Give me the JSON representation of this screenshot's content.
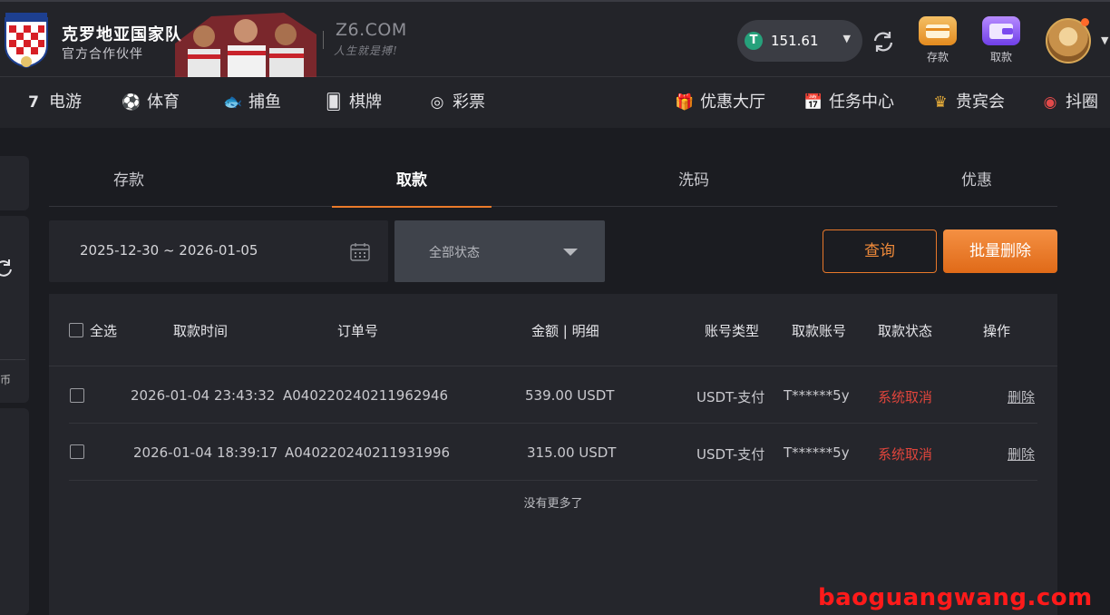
{
  "header": {
    "brand_title": "克罗地亚国家队",
    "brand_subtitle": "官方合作伙伴",
    "site_name": "Z6.COM",
    "site_slogan": "人生就是搏!",
    "balance": "151.61",
    "deposit_label": "存款",
    "withdraw_label": "取款"
  },
  "nav": {
    "items": [
      {
        "label": "电游",
        "icon": "slot-7-icon"
      },
      {
        "label": "体育",
        "icon": "soccer-ball-icon"
      },
      {
        "label": "捕鱼",
        "icon": "fish-icon"
      },
      {
        "label": "棋牌",
        "icon": "cards-icon"
      },
      {
        "label": "彩票",
        "icon": "lottery-ball-icon"
      },
      {
        "label": "优惠大厅",
        "icon": "gift-icon"
      },
      {
        "label": "任务中心",
        "icon": "task-calendar-icon"
      },
      {
        "label": "贵宾会",
        "icon": "crown-icon"
      },
      {
        "label": "抖圈",
        "icon": "douyin-circle-icon"
      }
    ]
  },
  "rail": {
    "label": "币"
  },
  "tabs": [
    {
      "label": "存款",
      "active": false
    },
    {
      "label": "取款",
      "active": true
    },
    {
      "label": "洗码",
      "active": false
    },
    {
      "label": "优惠",
      "active": false
    }
  ],
  "filters": {
    "date_range": "2025-12-30 ~ 2026-01-05",
    "status_selected": "全部状态",
    "query_label": "查询",
    "batch_delete_label": "批量删除"
  },
  "table": {
    "select_all_label": "全选",
    "columns": [
      "取款时间",
      "订单号",
      "金额 | 明细",
      "账号类型",
      "取款账号",
      "取款状态",
      "操作"
    ],
    "rows": [
      {
        "time": "2026-01-04 23:43:32",
        "order": "A040220240211962946",
        "amount": "539.00 USDT",
        "account_type": "USDT-支付",
        "account": "T******5y",
        "status": "系统取消",
        "action": "删除"
      },
      {
        "time": "2026-01-04 18:39:17",
        "order": "A040220240211931996",
        "amount": "315.00 USDT",
        "account_type": "USDT-支付",
        "account": "T******5y",
        "status": "系统取消",
        "action": "删除"
      }
    ],
    "no_more": "没有更多了"
  },
  "watermark": "baoguangwang.com",
  "colors": {
    "accent": "#ea7a2a",
    "status_cancel": "#e0453c",
    "background": "#1b1c21",
    "panel": "#25262c"
  }
}
